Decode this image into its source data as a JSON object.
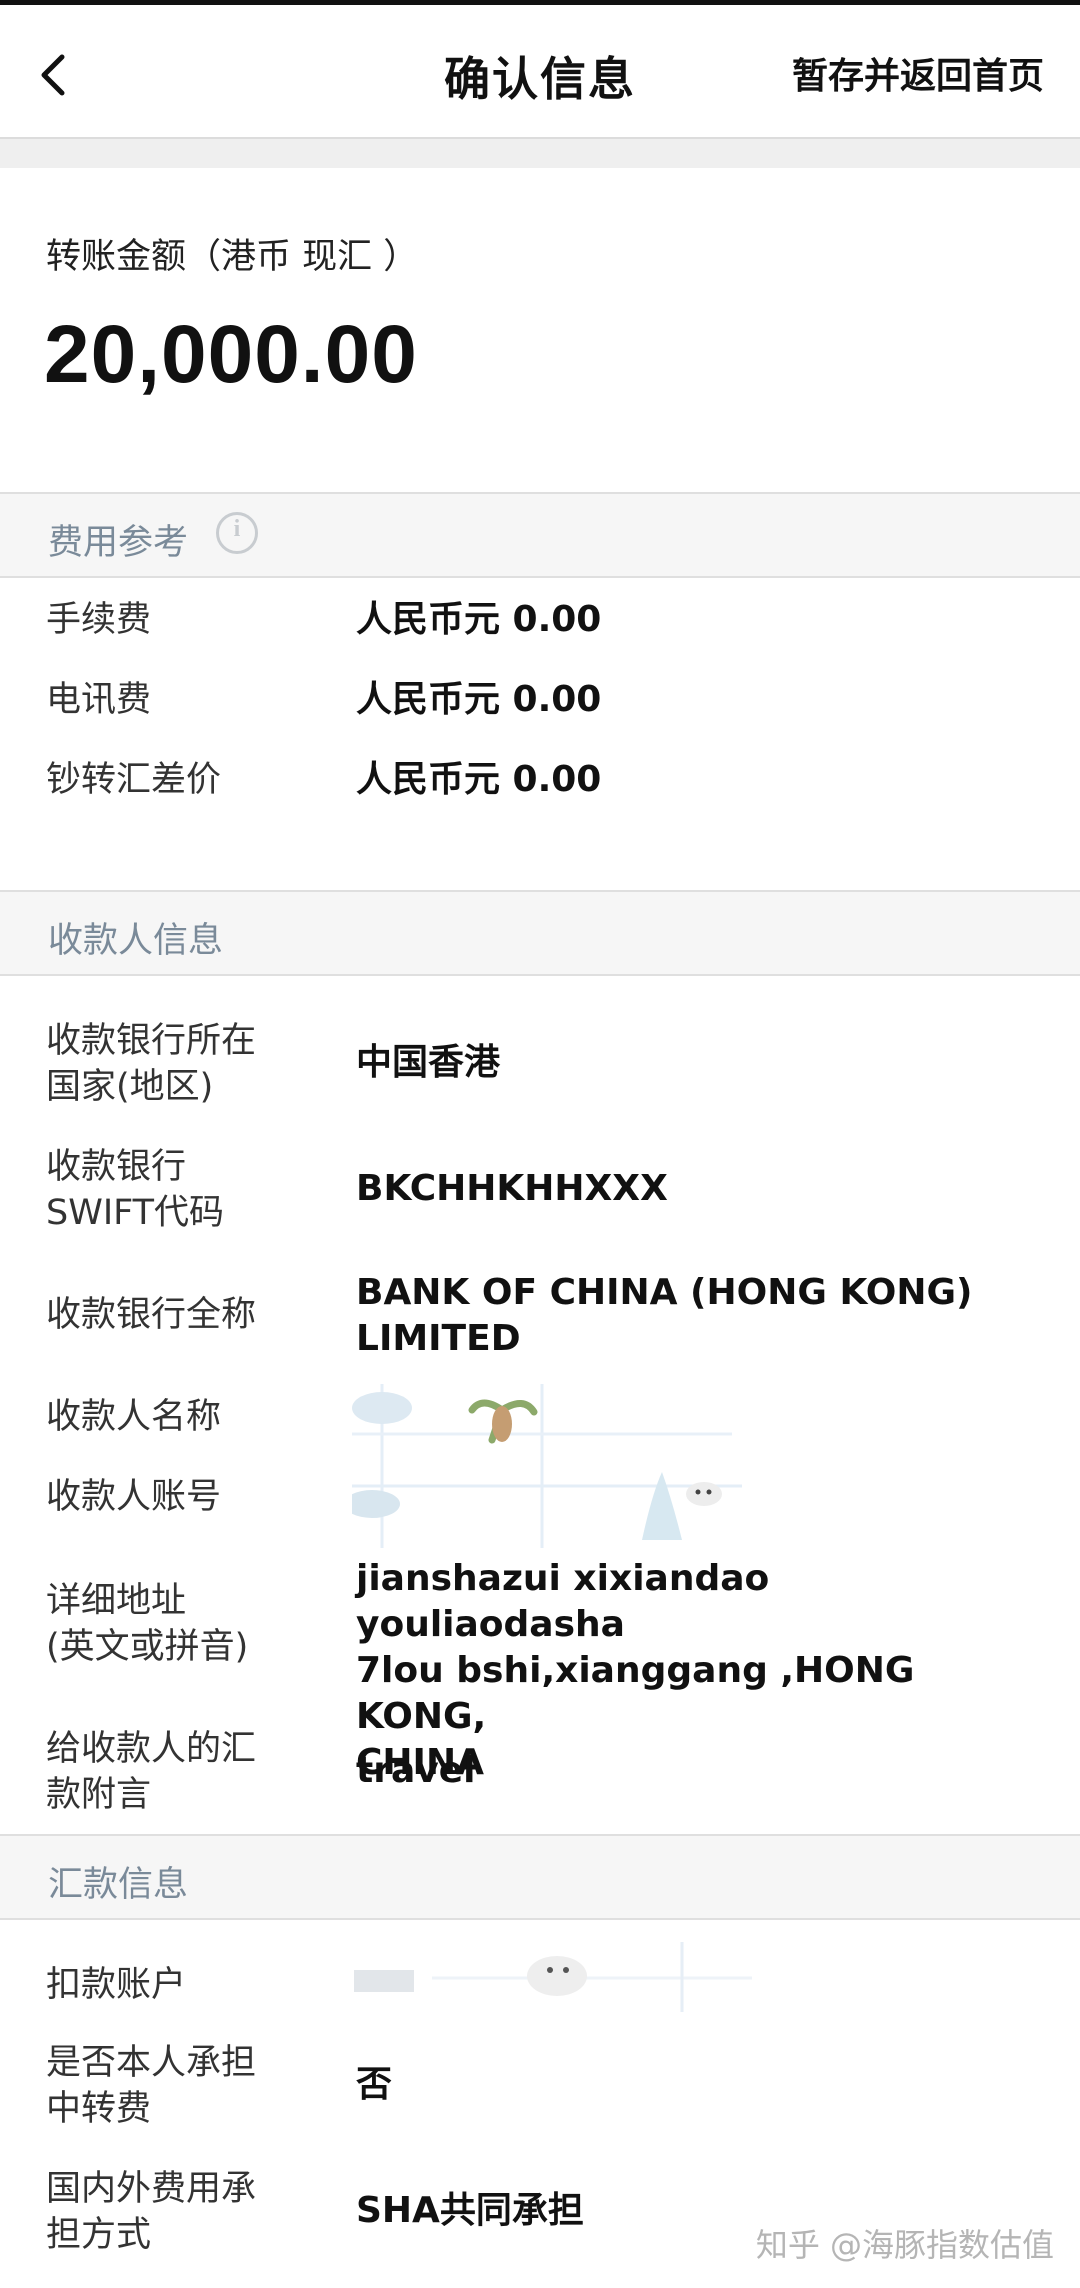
{
  "header": {
    "title": "确认信息",
    "save_label": "暂存并返回首页"
  },
  "amount": {
    "label": "转账金额（港币 现汇 ）",
    "value": "20,000.00"
  },
  "fees": {
    "section_title": "费用参考",
    "rows": [
      {
        "label": "手续费",
        "value": "人民币元 0.00"
      },
      {
        "label": "电讯费",
        "value": "人民币元 0.00"
      },
      {
        "label": "钞转汇差价",
        "value": "人民币元 0.00"
      }
    ]
  },
  "payee": {
    "section_title": "收款人信息",
    "bank_country": {
      "label": "收款银行所在\n国家(地区)",
      "value": "中国香港"
    },
    "swift": {
      "label": "收款银行\nSWIFT代码",
      "value": "BKCHHKHHXXX"
    },
    "bank_name": {
      "label": "收款银行全称",
      "value": "BANK OF CHINA (HONG KONG)\nLIMITED"
    },
    "name": {
      "label": "收款人名称"
    },
    "account": {
      "label": "收款人账号"
    },
    "address": {
      "label": "详细地址\n(英文或拼音)",
      "value": "jianshazui xixiandao youliaodasha\n7lou bshi,xianggang ,HONG KONG,\nCHINA"
    },
    "remark": {
      "label": "给收款人的汇\n款附言",
      "value": "travel"
    }
  },
  "remit": {
    "section_title": "汇款信息",
    "debit_account": {
      "label": "扣款账户"
    },
    "bear_fee": {
      "label": "是否本人承担\n中转费",
      "value": "否"
    },
    "fee_mode": {
      "label": "国内外费用承\n担方式",
      "value": "SHA共同承担"
    }
  },
  "watermark": "知乎 @海豚指数估值",
  "colors": {
    "section_text": "#7a8a99",
    "section_bg": "#f6f6f6",
    "divider": "#dfdfdf"
  }
}
